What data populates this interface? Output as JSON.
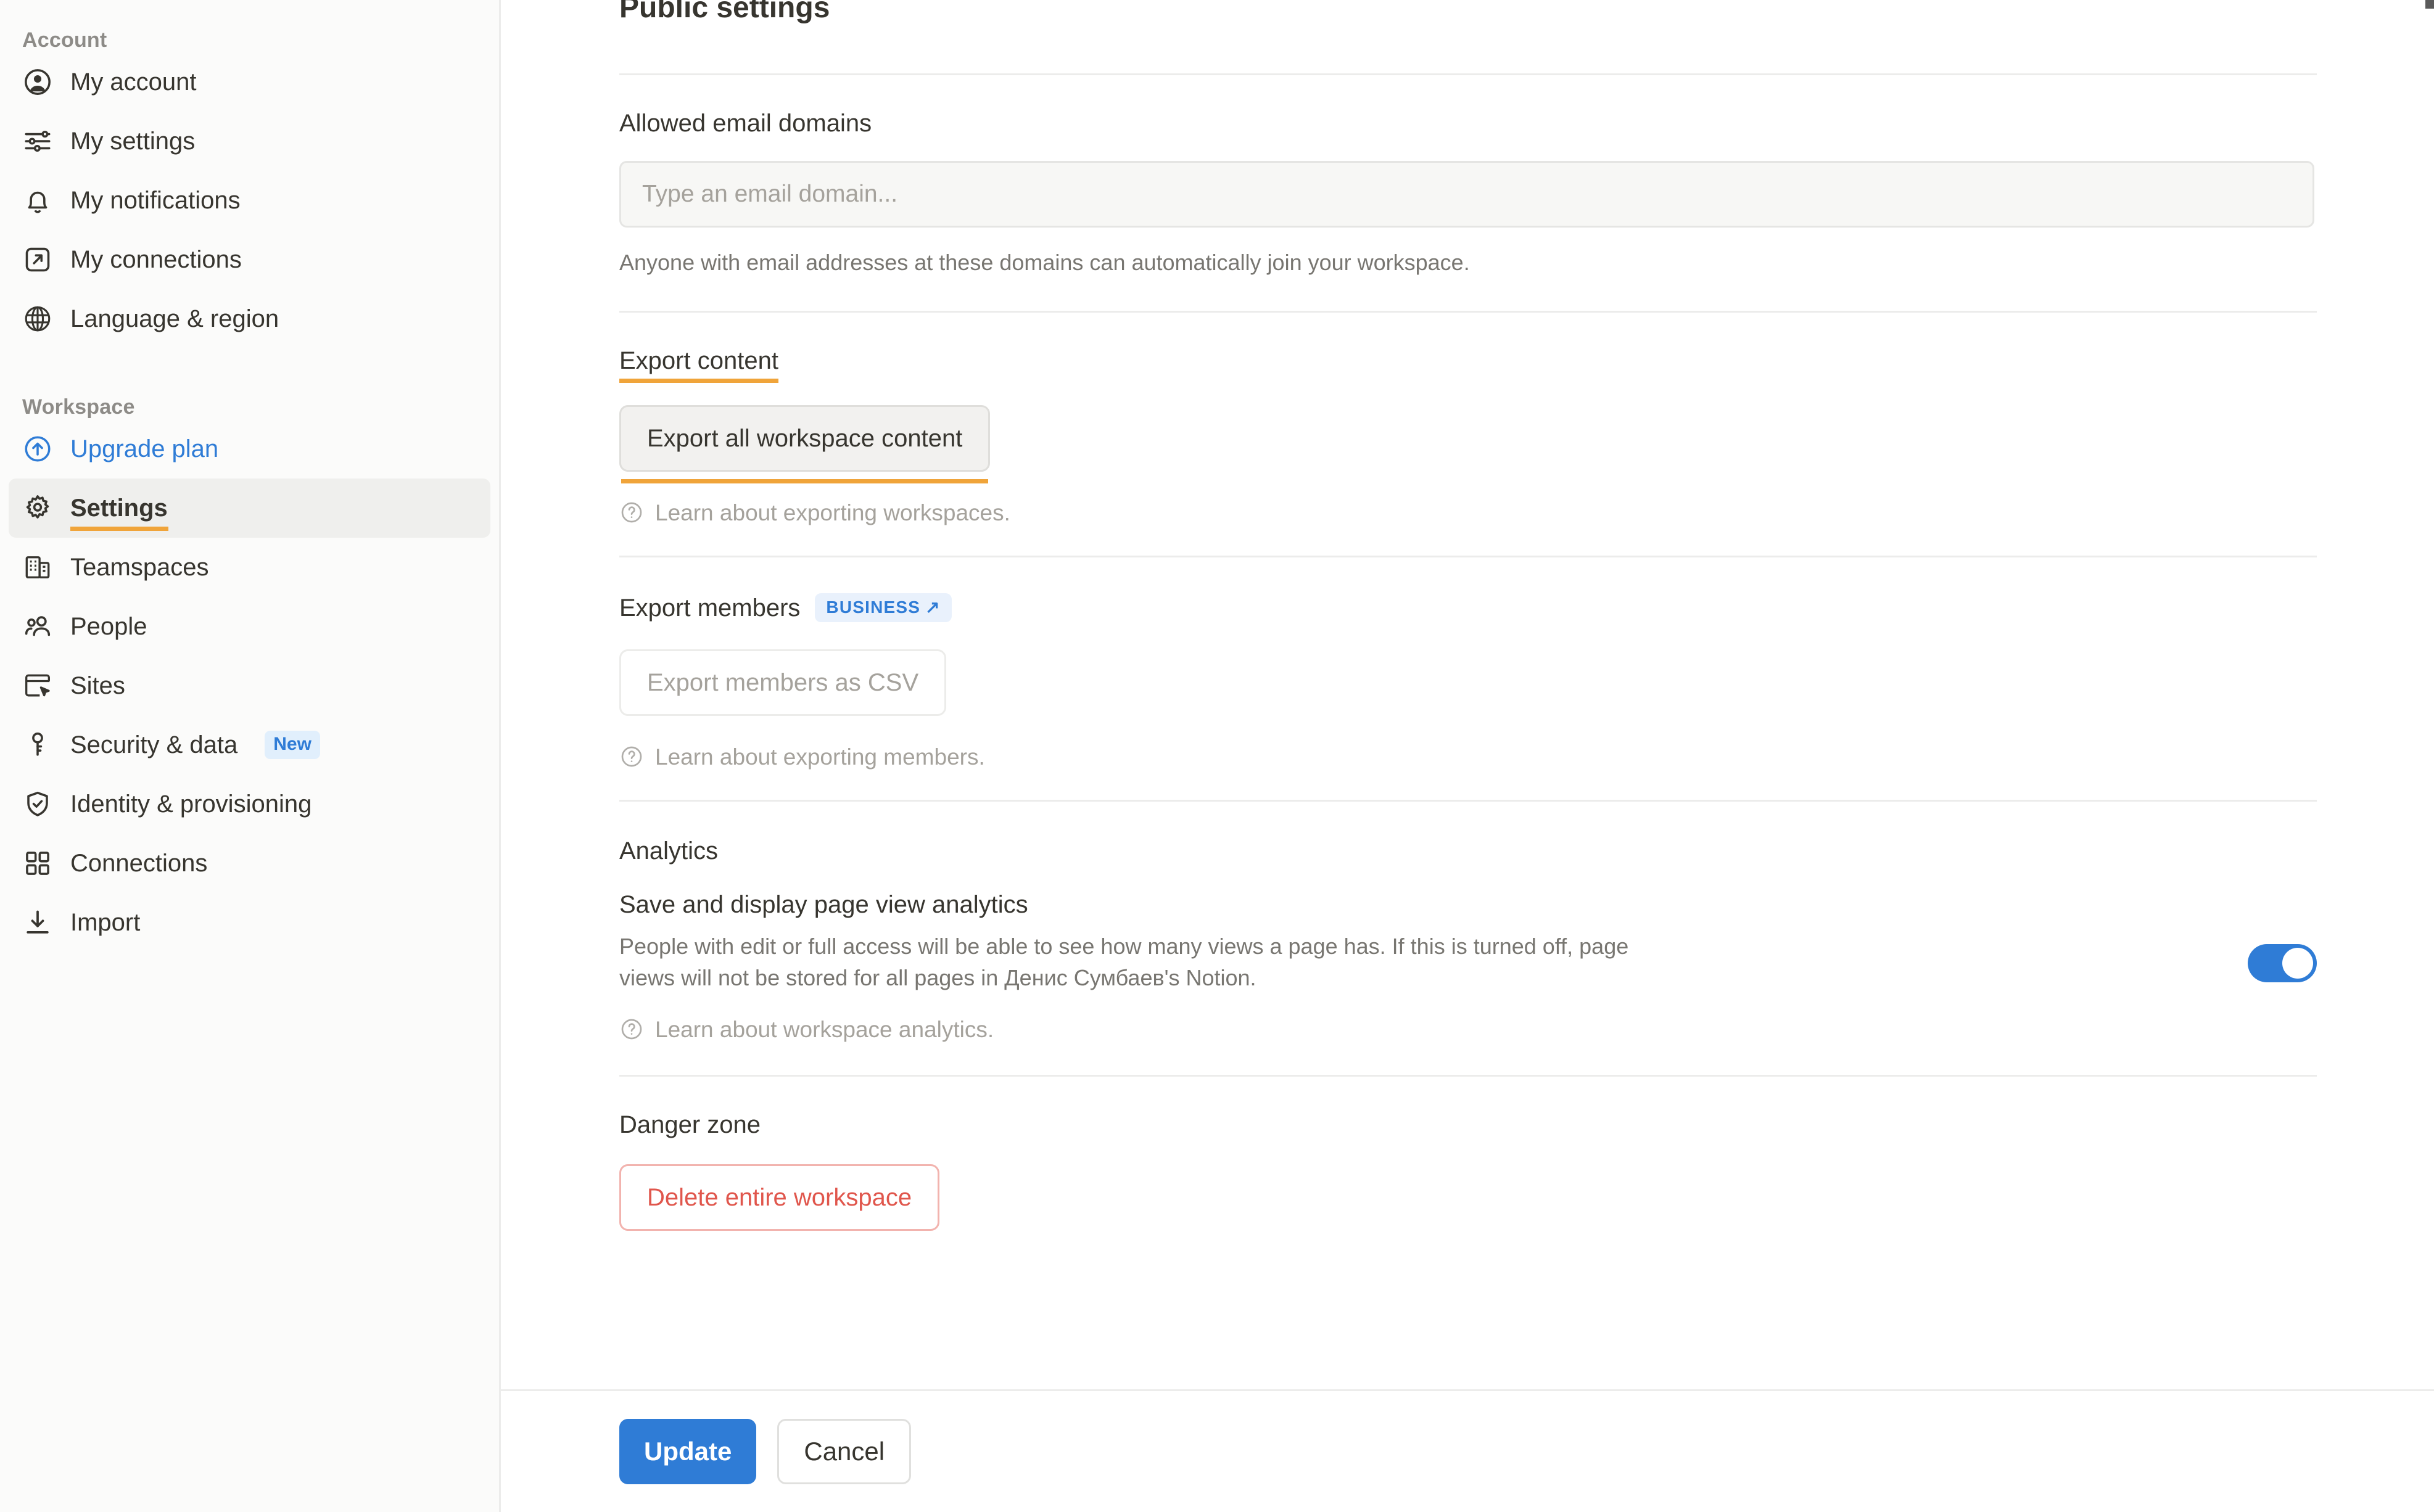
{
  "sidebar": {
    "groups": [
      {
        "label": "Account",
        "items": [
          {
            "label": "My account",
            "icon": "user-circle-icon"
          },
          {
            "label": "My settings",
            "icon": "sliders-icon"
          },
          {
            "label": "My notifications",
            "icon": "bell-icon"
          },
          {
            "label": "My connections",
            "icon": "external-link-box-icon"
          },
          {
            "label": "Language & region",
            "icon": "globe-icon"
          }
        ]
      },
      {
        "label": "Workspace",
        "items": [
          {
            "label": "Upgrade plan",
            "icon": "arrow-up-circle-icon"
          },
          {
            "label": "Settings",
            "icon": "gear-icon"
          },
          {
            "label": "Teamspaces",
            "icon": "building-icon"
          },
          {
            "label": "People",
            "icon": "people-icon"
          },
          {
            "label": "Sites",
            "icon": "browser-cursor-icon"
          },
          {
            "label": "Security & data",
            "icon": "key-icon",
            "badge": "New"
          },
          {
            "label": "Identity & provisioning",
            "icon": "shield-check-icon"
          },
          {
            "label": "Connections",
            "icon": "grid-squares-icon"
          },
          {
            "label": "Import",
            "icon": "download-arrow-icon"
          }
        ]
      }
    ]
  },
  "main": {
    "page_title": "Public settings",
    "allowed_domains": {
      "label": "Allowed email domains",
      "placeholder": "Type an email domain...",
      "helper": "Anyone with email addresses at these domains can automatically join your workspace."
    },
    "export_content": {
      "label": "Export content",
      "button": "Export all workspace content",
      "learn": "Learn about exporting workspaces."
    },
    "export_members": {
      "label": "Export members",
      "plan_badge": "BUSINESS",
      "plan_badge_arrow": "↗",
      "button": "Export members as CSV",
      "learn": "Learn about exporting members."
    },
    "analytics": {
      "label": "Analytics",
      "toggle_title": "Save and display page view analytics",
      "toggle_desc": "People with edit or full access will be able to see how many views a page has. If this is turned off, page views will not be stored for all pages in Денис Сумбаев's Notion.",
      "learn": "Learn about workspace analytics.",
      "toggle_state": "on"
    },
    "danger_zone": {
      "label": "Danger zone",
      "button": "Delete entire workspace"
    }
  },
  "footer": {
    "update_label": "Update",
    "cancel_label": "Cancel"
  },
  "colors": {
    "accent_blue": "#2f7cd6",
    "accent_orange": "#f0a43a",
    "danger_red": "#e0564c",
    "sidebar_bg": "#fbfbfa",
    "active_bg": "#efefed"
  }
}
